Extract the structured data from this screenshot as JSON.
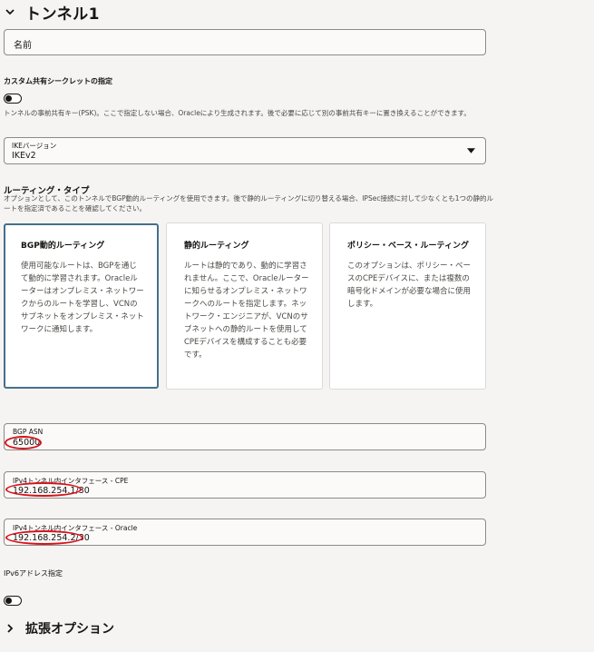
{
  "tunnel": {
    "title": "トンネル1",
    "name_placeholder": "名前"
  },
  "custom_secret": {
    "label": "カスタム共有シークレットの指定",
    "enabled": false,
    "help": "トンネルの事前共有キー(PSK)。ここで指定しない場合、Oracleにより生成されます。後で必要に応じて別の事前共有キーに置き換えることができます。"
  },
  "ike": {
    "label": "IKEバージョン",
    "value": "IKEv2"
  },
  "routing": {
    "title": "ルーティング・タイプ",
    "help": "オプションとして、このトンネルでBGP動的ルーティングを使用できます。後で静的ルーティングに切り替える場合、IPSec接続に対して少なくとも1つの静的ルートを指定済であることを確認してください。",
    "options": [
      {
        "title": "BGP動的ルーティング",
        "desc": "使用可能なルートは、BGPを通じて動的に学習されます。Oracleルーターはオンプレミス・ネットワークからのルートを学習し、VCNのサブネットをオンプレミス・ネットワークに通知します。",
        "selected": true
      },
      {
        "title": "静的ルーティング",
        "desc": "ルートは静的であり、動的に学習されません。ここで、Oracleルーターに知らせるオンプレミス・ネットワークへのルートを指定します。ネットワーク・エンジニアが、VCNのサブネットへの静的ルートを使用してCPEデバイスを構成することも必要です。",
        "selected": false
      },
      {
        "title": "ポリシー・ベース・ルーティング",
        "desc": "このオプションは、ポリシー・ベースのCPEデバイスに、または複数の暗号化ドメインが必要な場合に使用します。",
        "selected": false
      }
    ]
  },
  "bgp_asn": {
    "label": "BGP ASN",
    "value": "65000"
  },
  "ipv4_cpe": {
    "label": "IPv4トンネル内インタフェース - CPE",
    "value": "192.168.254.1/30"
  },
  "ipv4_oracle": {
    "label": "IPv4トンネル内インタフェース - Oracle",
    "value": "192.168.254.2/30"
  },
  "ipv6": {
    "label": "IPv6アドレス指定",
    "enabled": false
  },
  "advanced": {
    "title": "拡張オプション"
  },
  "colors": {
    "background": "#f5f4f2",
    "selected_border": "#44708b",
    "annotation_red": "#d6121b"
  }
}
